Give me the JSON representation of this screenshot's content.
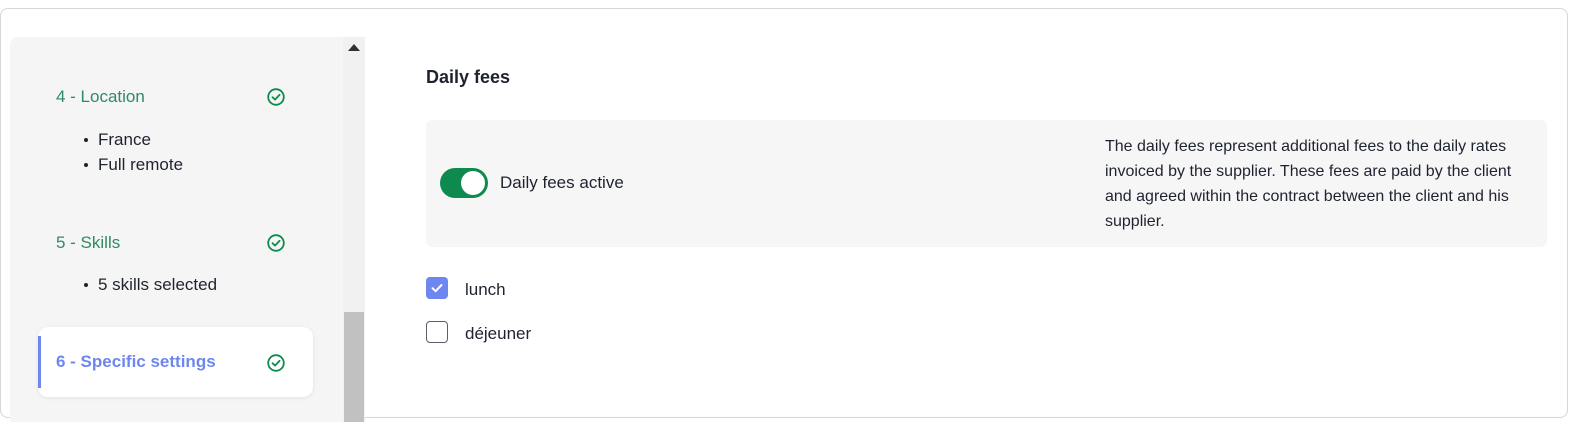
{
  "sidebar": {
    "steps": [
      {
        "label": "4 - Location",
        "items": [
          "France",
          "Full remote"
        ],
        "status": "complete"
      },
      {
        "label": "5 - Skills",
        "items": [
          "5 skills selected"
        ],
        "status": "complete"
      },
      {
        "label": "6 - Specific settings",
        "items": [],
        "status": "active"
      }
    ]
  },
  "main": {
    "title": "Daily fees",
    "toggle": {
      "label": "Daily fees active",
      "on": true
    },
    "description": "The daily fees represent additional fees to the daily rates invoiced by the supplier. These fees are paid by the client and agreed within the contract between the client and his supplier.",
    "options": [
      {
        "label": "lunch",
        "checked": true
      },
      {
        "label": "déjeuner",
        "checked": false
      }
    ]
  },
  "colors": {
    "step_complete": "#2e8b62",
    "step_active": "#6e86f0",
    "toggle_on": "#0f8a4f",
    "checkbox_checked": "#6e86f0"
  }
}
